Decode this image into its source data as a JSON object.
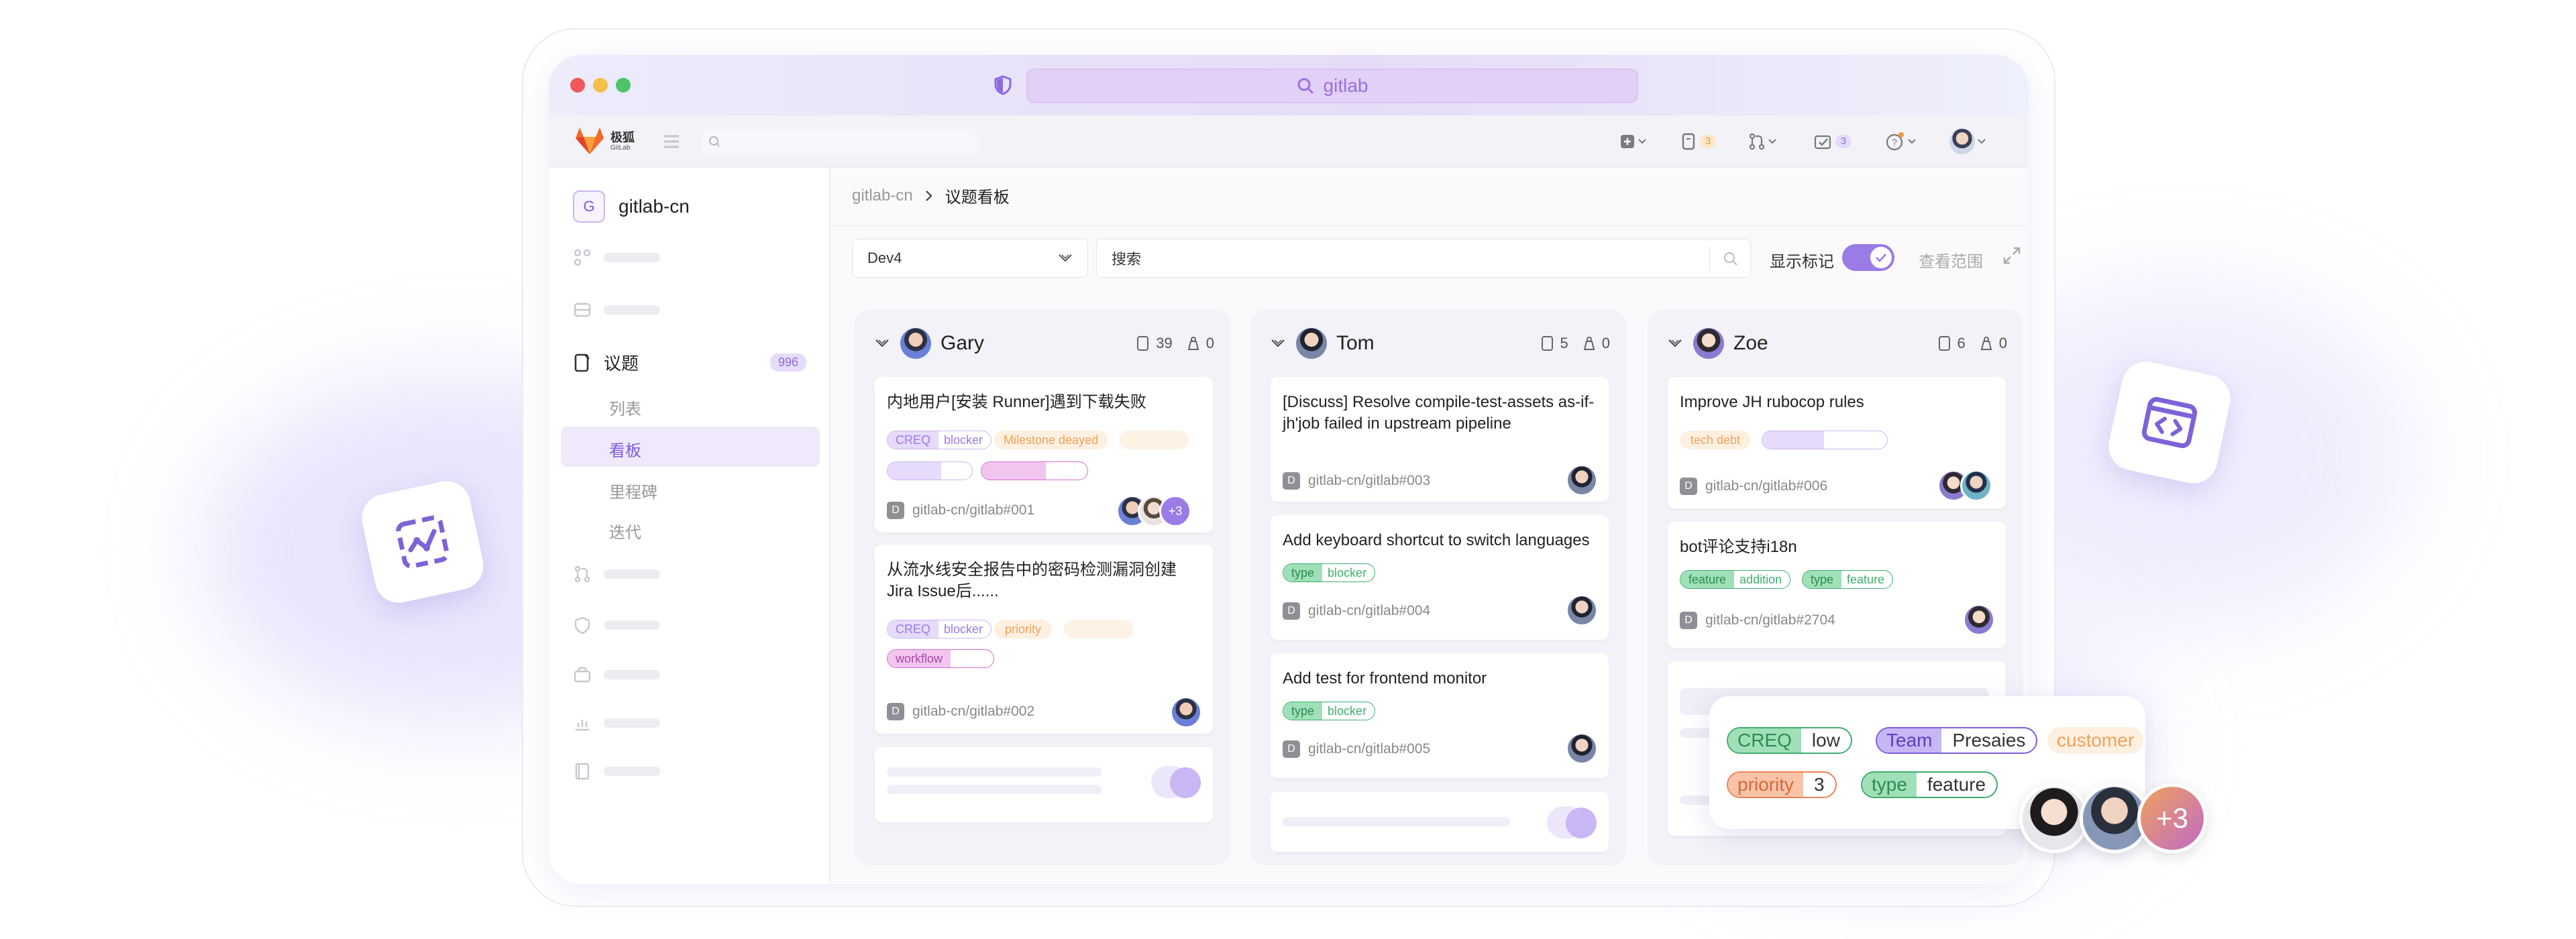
{
  "browser": {
    "url_text": "gitlab"
  },
  "toolbar": {
    "logo_cn": "极狐",
    "logo_en": "GitLab",
    "issues_count": "3",
    "todos_count": "3"
  },
  "sidebar": {
    "project_initial": "G",
    "project_name": "gitlab-cn",
    "issues_label": "议题",
    "issues_count": "996",
    "sub_items": [
      "列表",
      "看板",
      "里程碑",
      "迭代"
    ],
    "active_sub_item": "看板"
  },
  "breadcrumb": {
    "parent": "gitlab-cn",
    "current": "议题看板"
  },
  "filters": {
    "board_select": "Dev4",
    "search_placeholder": "搜索",
    "show_labels_text": "显示标记",
    "show_labels_on": true,
    "view_scope_text": "查看范围"
  },
  "columns": [
    {
      "assignee": "Gary",
      "issue_count": "39",
      "weight": "0",
      "avatar_color": "#6a7fd8",
      "cards": [
        {
          "title": "内地用户[安装 Runner]遇到下载失败",
          "tags": [
            {
              "key": "CREQ",
              "value": "blocker"
            },
            {
              "key": "",
              "value": "Milestone deayed"
            },
            {
              "key": "",
              "value": ""
            },
            {
              "key": "",
              "value": ""
            },
            {
              "key": "",
              "value": ""
            }
          ],
          "ref": "gitlab-cn/gitlab#001",
          "avatar_more": "+3"
        },
        {
          "title": "从流水线安全报告中的密码检测漏洞创建Jira Issue后......",
          "tags": [
            {
              "key": "CREQ",
              "value": "blocker"
            },
            {
              "key": "",
              "value": "priority"
            },
            {
              "key": "",
              "value": ""
            },
            {
              "key": "workflow",
              "value": ""
            }
          ],
          "ref": "gitlab-cn/gitlab#002"
        }
      ]
    },
    {
      "assignee": "Tom",
      "issue_count": "5",
      "weight": "0",
      "avatar_color": "#3b4a6a",
      "cards": [
        {
          "title": "[Discuss] Resolve compile-test-assets as-if-jh'job failed in upstream pipeline",
          "tags": [],
          "ref": "gitlab-cn/gitlab#003"
        },
        {
          "title": "Add keyboard shortcut to switch languages",
          "tags": [
            {
              "key": "type",
              "value": "blocker"
            }
          ],
          "ref": "gitlab-cn/gitlab#004"
        },
        {
          "title": "Add test for frontend monitor",
          "tags": [
            {
              "key": "type",
              "value": "blocker"
            }
          ],
          "ref": "gitlab-cn/gitlab#005"
        }
      ]
    },
    {
      "assignee": "Zoe",
      "issue_count": "6",
      "weight": "0",
      "avatar_color": "#8a7ad0",
      "cards": [
        {
          "title": "Improve JH rubocop rules",
          "tags": [
            {
              "key": "",
              "value": "tech debt"
            },
            {
              "key": "",
              "value": ""
            }
          ],
          "ref": "gitlab-cn/gitlab#006"
        },
        {
          "title": "bot评论支持i18n",
          "tags": [
            {
              "key": "feature",
              "value": "addition"
            },
            {
              "key": "type",
              "value": "feature"
            }
          ],
          "ref": "gitlab-cn/gitlab#2704"
        }
      ]
    }
  ],
  "popup": {
    "tags": [
      {
        "key": "CREQ",
        "value": "low"
      },
      {
        "key": "Team",
        "value": "Presaies"
      },
      {
        "key": "",
        "value": "customer"
      },
      {
        "key": "priority",
        "value": "3"
      },
      {
        "key": "type",
        "value": "feature"
      }
    ],
    "avatar_more": "+3"
  },
  "colors": {
    "accent": "#9b7be6",
    "green": "#3fae6e",
    "orange": "#f0a25a",
    "pink": "#d46cd0",
    "purple": "#7d5ce0"
  }
}
